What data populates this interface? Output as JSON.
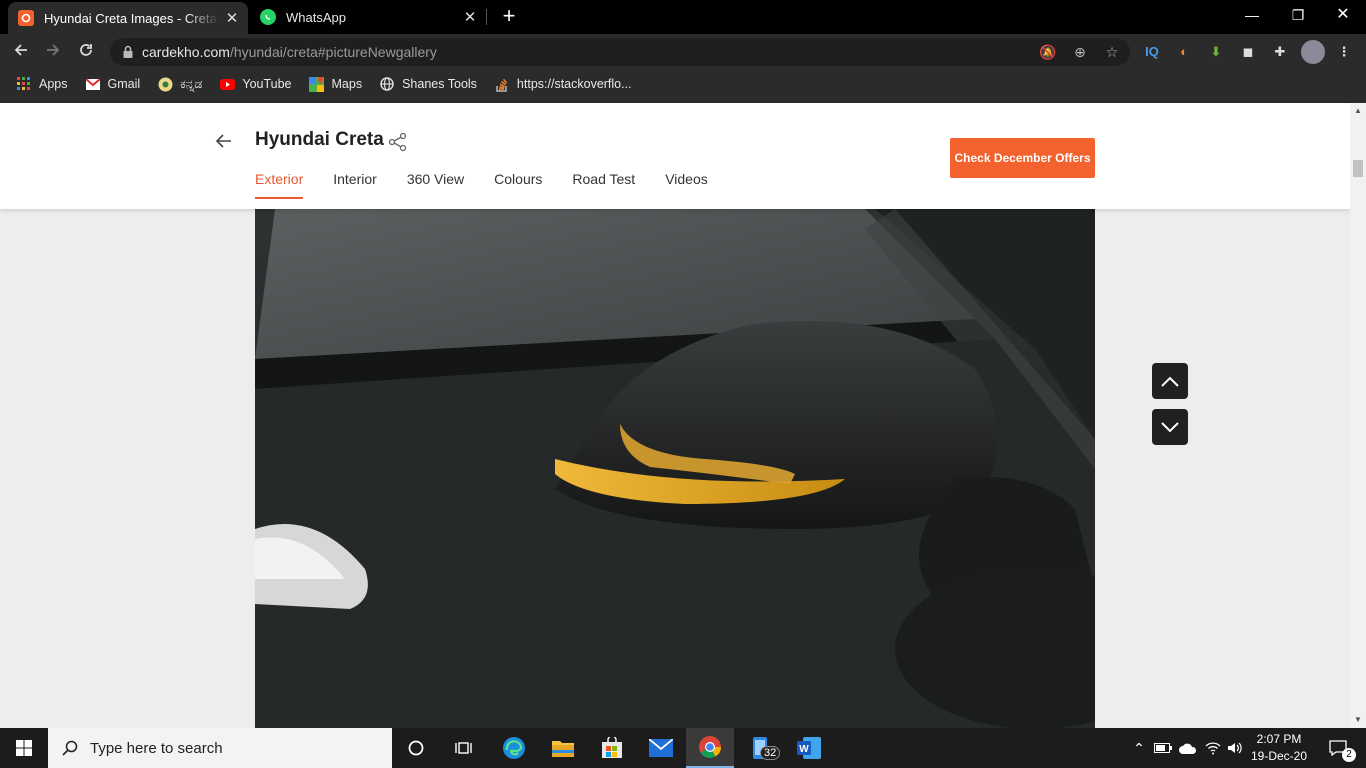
{
  "browser": {
    "tabs": [
      {
        "title": "Hyundai Creta Images - Creta Interior",
        "active": true
      },
      {
        "title": "WhatsApp",
        "active": false
      }
    ],
    "url_host": "cardekho.com",
    "url_path": "/hyundai/creta#pictureNewgallery",
    "extension_iq": "IQ",
    "bookmarks": [
      {
        "label": "Apps",
        "icon": "apps-grid-icon"
      },
      {
        "label": "Gmail",
        "icon": "gmail-icon"
      },
      {
        "label": "ಕನ್ನಡ",
        "icon": "kannada-site-icon"
      },
      {
        "label": "YouTube",
        "icon": "youtube-icon"
      },
      {
        "label": "Maps",
        "icon": "maps-icon"
      },
      {
        "label": "Shanes Tools",
        "icon": "globe-icon"
      },
      {
        "label": "https://stackoverflo...",
        "icon": "stackoverflow-icon"
      }
    ]
  },
  "page": {
    "car_title": "Hyundai Creta",
    "tabs": [
      "Exterior",
      "Interior",
      "360 View",
      "Colours",
      "Road Test",
      "Videos"
    ],
    "active_tab": "Exterior",
    "offers_button": "Check December Offers",
    "accent_color": "#f2612e",
    "image_subject": "side mirror with turn indicator"
  },
  "taskbar": {
    "search_placeholder": "Type here to search",
    "badge_count": "32",
    "time": "2:07 PM",
    "date": "19-Dec-20",
    "notification_count": "2"
  }
}
